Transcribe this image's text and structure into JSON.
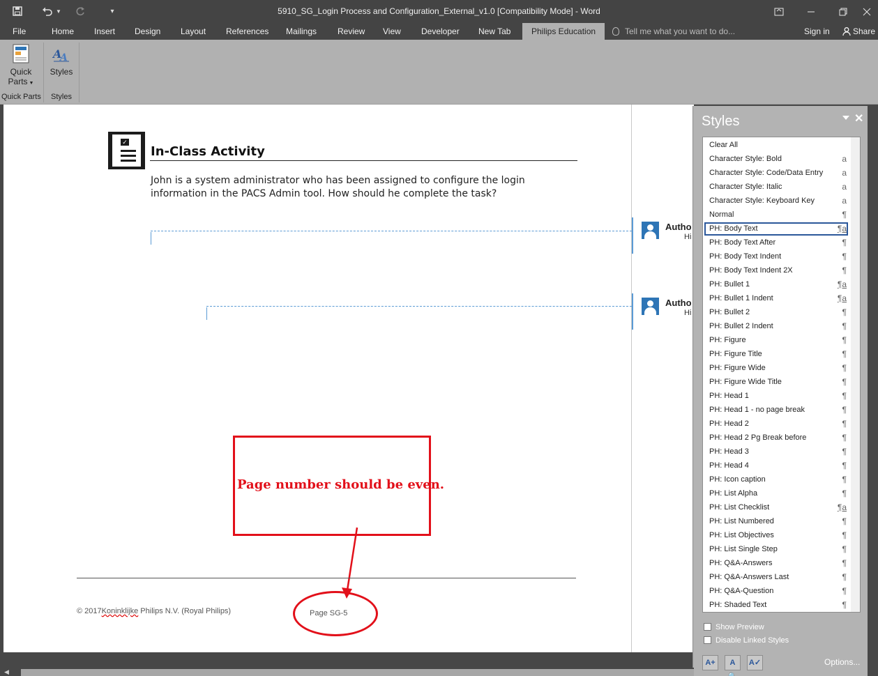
{
  "window": {
    "title": "5910_SG_Login Process and Configuration_External_v1.0 [Compatibility Mode] - Word"
  },
  "quick_access": {
    "save_icon": "save-icon",
    "undo_icon": "undo-icon",
    "redo_icon": "redo-icon",
    "customize_icon": "chevron-down-icon"
  },
  "tabs": [
    "File",
    "Home",
    "Insert",
    "Design",
    "Layout",
    "References",
    "Mailings",
    "Review",
    "View",
    "Developer",
    "New Tab",
    "Philips Education"
  ],
  "active_tab": "Philips Education",
  "tell_me": "Tell me what you want to do...",
  "sign_in": "Sign in",
  "share": "Share",
  "ribbon": {
    "quick_parts": {
      "line1": "Quick",
      "line2": "Parts",
      "group": "Quick Parts"
    },
    "styles": {
      "label": "Styles",
      "group": "Styles"
    }
  },
  "document": {
    "heading": "In-Class Activity",
    "body": "John is a system administrator who has been assigned to configure the login information in the PACS Admin tool. How should he complete the task?",
    "comments": [
      {
        "author": "Autho",
        "text": "Hi"
      },
      {
        "author": "Autho",
        "text": "Hi"
      }
    ],
    "callout": "Page number should be even.",
    "footer": {
      "copyright_prefix": "© 2017",
      "copyright_squiggle": "Koninklijke",
      "copyright_suffix": " Philips N.V. (Royal Philips)",
      "page_number": "Page SG-5"
    }
  },
  "styles_pane": {
    "title": "Styles",
    "items": [
      {
        "name": "Clear All",
        "icon": ""
      },
      {
        "name": "Character Style: Bold",
        "icon": "a"
      },
      {
        "name": "Character Style: Code/Data Entry",
        "icon": "a"
      },
      {
        "name": "Character Style: Italic",
        "icon": "a"
      },
      {
        "name": "Character Style: Keyboard Key",
        "icon": "a"
      },
      {
        "name": "Normal",
        "icon": "¶"
      },
      {
        "name": "PH: Body Text",
        "icon": "¶a"
      },
      {
        "name": "PH: Body Text After",
        "icon": "¶"
      },
      {
        "name": "PH: Body Text Indent",
        "icon": "¶"
      },
      {
        "name": "PH: Body Text Indent 2X",
        "icon": "¶"
      },
      {
        "name": "PH: Bullet 1",
        "icon": "¶a"
      },
      {
        "name": "PH: Bullet 1 Indent",
        "icon": "¶a"
      },
      {
        "name": "PH: Bullet 2",
        "icon": "¶"
      },
      {
        "name": "PH: Bullet 2 Indent",
        "icon": "¶"
      },
      {
        "name": "PH: Figure",
        "icon": "¶"
      },
      {
        "name": "PH: Figure Title",
        "icon": "¶"
      },
      {
        "name": "PH: Figure Wide",
        "icon": "¶"
      },
      {
        "name": "PH: Figure Wide Title",
        "icon": "¶"
      },
      {
        "name": "PH: Head 1",
        "icon": "¶"
      },
      {
        "name": "PH: Head 1 - no page break",
        "icon": "¶"
      },
      {
        "name": "PH: Head 2",
        "icon": "¶"
      },
      {
        "name": "PH: Head 2 Pg Break before",
        "icon": "¶"
      },
      {
        "name": "PH: Head 3",
        "icon": "¶"
      },
      {
        "name": "PH: Head 4",
        "icon": "¶"
      },
      {
        "name": "PH: Icon caption",
        "icon": "¶"
      },
      {
        "name": "PH: List Alpha",
        "icon": "¶"
      },
      {
        "name": "PH: List Checklist",
        "icon": "¶a"
      },
      {
        "name": "PH: List Numbered",
        "icon": "¶"
      },
      {
        "name": "PH: List Objectives",
        "icon": "¶"
      },
      {
        "name": "PH: List Single Step",
        "icon": "¶"
      },
      {
        "name": "PH: Q&A-Answers",
        "icon": "¶"
      },
      {
        "name": "PH: Q&A-Answers Last",
        "icon": "¶"
      },
      {
        "name": "PH: Q&A-Question",
        "icon": "¶"
      },
      {
        "name": "PH: Shaded Text",
        "icon": "¶"
      }
    ],
    "selected": "PH: Body Text",
    "show_preview": "Show Preview",
    "disable_linked": "Disable Linked Styles",
    "options": "Options..."
  },
  "colors": {
    "accent": "#2b579a",
    "annotation_red": "#e2101a",
    "comment_blue": "#2e75b6"
  }
}
